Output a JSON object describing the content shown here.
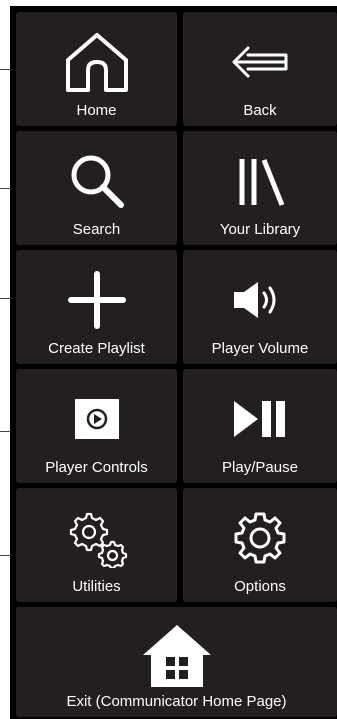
{
  "tiles": [
    {
      "label": "Home",
      "icon": "home-icon"
    },
    {
      "label": "Back",
      "icon": "arrow-left-icon"
    },
    {
      "label": "Search",
      "icon": "search-icon"
    },
    {
      "label": "Your Library",
      "icon": "library-icon"
    },
    {
      "label": "Create Playlist",
      "icon": "plus-icon"
    },
    {
      "label": "Player Volume",
      "icon": "volume-icon"
    },
    {
      "label": "Player Controls",
      "icon": "player-controls-icon"
    },
    {
      "label": "Play/Pause",
      "icon": "play-pause-icon"
    },
    {
      "label": "Utilities",
      "icon": "gears-icon"
    },
    {
      "label": "Options",
      "icon": "gear-icon"
    },
    {
      "label": "Exit (Communicator Home Page)",
      "icon": "house-exit-icon"
    }
  ],
  "colors": {
    "background": "#000000",
    "tile": "#231f20",
    "foreground": "#ffffff"
  }
}
